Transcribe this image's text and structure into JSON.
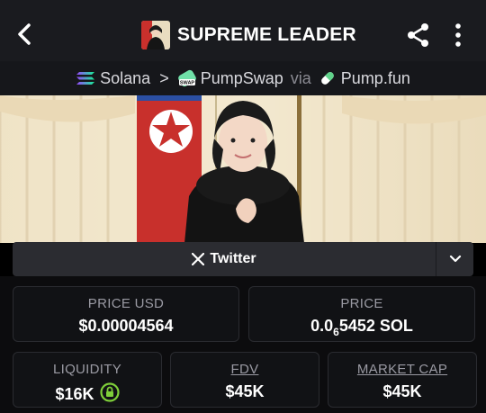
{
  "header": {
    "title": "SUPREME LEADER",
    "back_icon": "chevron-left-icon",
    "share_icon": "share-icon",
    "more_icon": "more-vertical-icon"
  },
  "chain": {
    "network": "Solana",
    "dex": "PumpSwap",
    "via": "via",
    "launchpad": "Pump.fun",
    "dex_badge": "SWAP"
  },
  "social": {
    "twitter_label": "Twitter"
  },
  "stats": {
    "price_usd_label": "PRICE USD",
    "price_usd_value": "$0.00004564",
    "price_label": "PRICE",
    "price_prefix": "0.0",
    "price_zeros": "6",
    "price_digits": "5452",
    "price_unit": "SOL",
    "liquidity_label": "LIQUIDITY",
    "liquidity_value": "$16K",
    "fdv_label": "FDV",
    "fdv_value": "$45K",
    "mcap_label": "MARKET CAP",
    "mcap_value": "$45K"
  },
  "colors": {
    "lock_green": "#7fcf3a",
    "pumpswap_green": "#6fe0a8"
  }
}
